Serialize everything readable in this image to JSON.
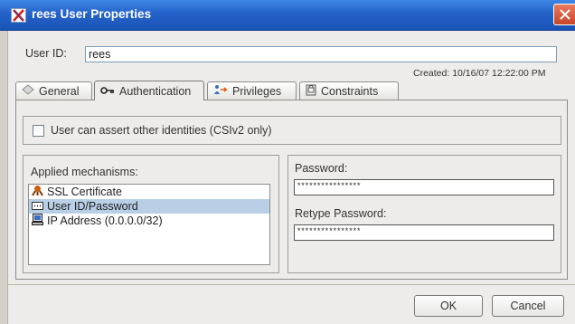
{
  "window": {
    "title": "rees User Properties"
  },
  "user": {
    "id_label": "User ID:",
    "id_value": "rees",
    "created": "Created: 10/16/07 12:22:00 PM"
  },
  "tabs": [
    {
      "label": "General",
      "icon": "general-icon"
    },
    {
      "label": "Authentication",
      "icon": "key-icon",
      "active": true
    },
    {
      "label": "Privileges",
      "icon": "privileges-icon"
    },
    {
      "label": "Constraints",
      "icon": "constraints-icon"
    }
  ],
  "auth": {
    "assert_label": "User can assert other identities (CSIv2 only)",
    "assert_checked": false,
    "mechanisms_title": "Applied mechanisms:",
    "mechanisms": [
      {
        "label": "SSL Certificate",
        "icon": "certificate-icon",
        "selected": false
      },
      {
        "label": "User ID/Password",
        "icon": "password-icon",
        "selected": true
      },
      {
        "label": "IP Address (0.0.0.0/32)",
        "icon": "computer-icon",
        "selected": false
      }
    ],
    "password_label": "Password:",
    "password_value": "****************",
    "retype_label": "Retype Password:",
    "retype_value": "****************"
  },
  "buttons": {
    "ok": "OK",
    "cancel": "Cancel"
  },
  "colors": {
    "titlebar": "#2462c8",
    "selection": "#b8cfe5",
    "panel": "#edecea"
  }
}
